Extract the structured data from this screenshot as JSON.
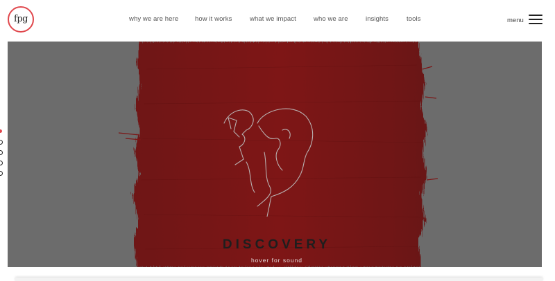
{
  "logo": {
    "text": "fpg",
    "ring_color": "#e0474c"
  },
  "nav": {
    "items": [
      {
        "label": "why we are here"
      },
      {
        "label": "how it works"
      },
      {
        "label": "what we impact"
      },
      {
        "label": "who we are"
      },
      {
        "label": "insights"
      },
      {
        "label": "tools"
      }
    ]
  },
  "menu": {
    "label": "menu",
    "icon": "hamburger-icon"
  },
  "hero": {
    "title": "DISCOVERY",
    "subtitle": "hover for sound",
    "background_color": "#6c6c6c",
    "paint_color": "#7c1616",
    "illustration": "line-art-head-icon"
  },
  "section_dots": {
    "count": 5,
    "active_index": 0,
    "active_color": "#e0474c"
  }
}
